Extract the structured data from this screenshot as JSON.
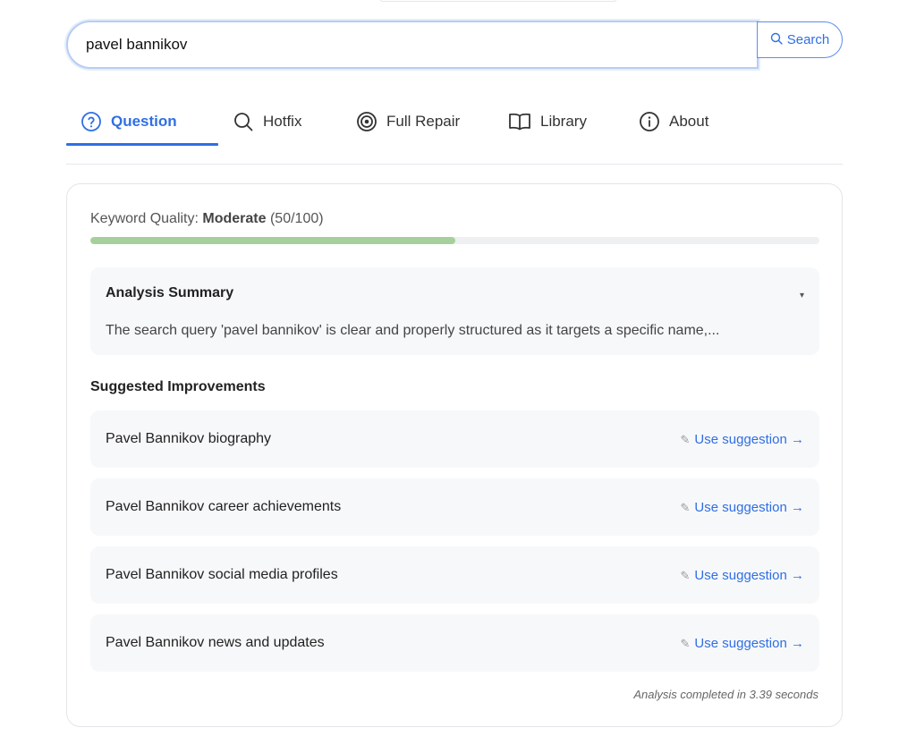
{
  "search": {
    "value": "pavel bannikov",
    "button_label": "Search",
    "button_icon": "search-icon"
  },
  "tabs": [
    {
      "label": "Question",
      "icon": "question-circle-icon",
      "active": true
    },
    {
      "label": "Hotfix",
      "icon": "search-icon",
      "active": false
    },
    {
      "label": "Full Repair",
      "icon": "target-icon",
      "active": false
    },
    {
      "label": "Library",
      "icon": "book-icon",
      "active": false
    },
    {
      "label": "About",
      "icon": "info-icon",
      "active": false
    }
  ],
  "keyword_quality": {
    "label": "Keyword Quality:",
    "rating": "Moderate",
    "score": "(50/100)",
    "progress_fraction": 0.5
  },
  "analysis": {
    "title": "Analysis Summary",
    "caret": "▾",
    "text": "The search query 'pavel bannikov' is clear and properly structured as it targets a specific name,..."
  },
  "suggestions": {
    "heading": "Suggested Improvements",
    "link_label": "Use suggestion →",
    "items": [
      "Pavel Bannikov biography",
      "Pavel Bannikov career achievements",
      "Pavel Bannikov social media profiles",
      "Pavel Bannikov news and updates"
    ]
  },
  "footer": {
    "note": "Analysis completed in 3.39 seconds"
  },
  "colors": {
    "accent": "#2f6fe4",
    "progress": "#a5d09b"
  }
}
